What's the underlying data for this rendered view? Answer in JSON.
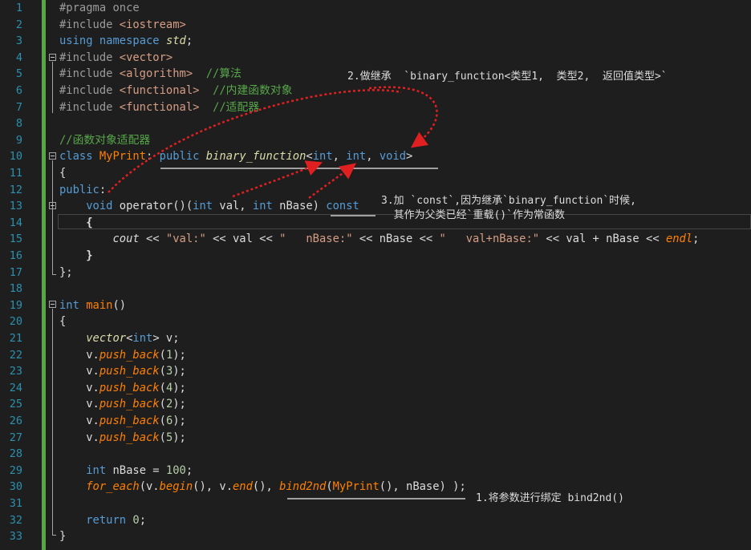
{
  "line_numbers": [
    "1",
    "2",
    "3",
    "4",
    "5",
    "6",
    "7",
    "8",
    "9",
    "10",
    "11",
    "12",
    "13",
    "14",
    "15",
    "16",
    "17",
    "18",
    "19",
    "20",
    "21",
    "22",
    "23",
    "24",
    "25",
    "26",
    "27",
    "28",
    "29",
    "30",
    "31",
    "32",
    "33"
  ],
  "code": {
    "l1": {
      "pp": "#pragma once"
    },
    "l2": {
      "pp": "#include ",
      "inc": "<iostream>"
    },
    "l3": {
      "kw1": "using",
      "kw2": "namespace",
      "ns": "std",
      "semi": ";"
    },
    "l4": {
      "pp": "#include ",
      "inc": "<vector>"
    },
    "l5": {
      "pp": "#include ",
      "inc": "<algorithm>",
      "cm": "  //算法"
    },
    "l6": {
      "pp": "#include ",
      "inc": "<functional>",
      "cm": "  //内建函数对象"
    },
    "l7": {
      "pp": "#include ",
      "inc": "<functional>",
      "cm": "  //适配器"
    },
    "l9": {
      "cm": "//函数对象适配器"
    },
    "l10": {
      "kw": "class",
      "name": "MyPrint",
      "colon": ": ",
      "pub": "public",
      "base": "binary_function",
      "lt": "<",
      "t1": "int",
      "c1": ", ",
      "t2": "int",
      "c2": ", ",
      "t3": "void",
      "gt": ">"
    },
    "l11": {
      "brace": "{"
    },
    "l12": {
      "kw": "public",
      "colon": ":"
    },
    "l13": {
      "indent": "    ",
      "void": "void",
      "op": " operator()(",
      "int1": "int",
      "p1": " val, ",
      "int2": "int",
      "p2": " nBase) ",
      "const": "const"
    },
    "l14": {
      "indent": "    ",
      "brace": "{"
    },
    "l15": {
      "indent": "        ",
      "cout": "cout",
      "a": " << ",
      "s1": "\"val:\"",
      "b": " << val << ",
      "s2": "\"   nBase:\"",
      "c": " << nBase << ",
      "s3": "\"   val+nBase:\"",
      "d": " << val + nBase << ",
      "endl": "endl",
      "e": ";"
    },
    "l16": {
      "indent": "    ",
      "brace": "}"
    },
    "l17": {
      "brace": "};"
    },
    "l19": {
      "int": "int",
      "main": "main",
      "rest": "()"
    },
    "l20": {
      "brace": "{"
    },
    "l21": {
      "indent": "    ",
      "vector": "vector",
      "lt": "<",
      "int": "int",
      "rest": "> v;"
    },
    "l22": {
      "indent": "    ",
      "v": "v.",
      "fn": "push_back",
      "open": "(",
      "n": "1",
      "close": ");"
    },
    "l23": {
      "indent": "    ",
      "v": "v.",
      "fn": "push_back",
      "open": "(",
      "n": "3",
      "close": ");"
    },
    "l24": {
      "indent": "    ",
      "v": "v.",
      "fn": "push_back",
      "open": "(",
      "n": "4",
      "close": ");"
    },
    "l25": {
      "indent": "    ",
      "v": "v.",
      "fn": "push_back",
      "open": "(",
      "n": "2",
      "close": ");"
    },
    "l26": {
      "indent": "    ",
      "v": "v.",
      "fn": "push_back",
      "open": "(",
      "n": "6",
      "close": ");"
    },
    "l27": {
      "indent": "    ",
      "v": "v.",
      "fn": "push_back",
      "open": "(",
      "n": "5",
      "close": ");"
    },
    "l29": {
      "indent": "    ",
      "int": "int",
      "rest": " nBase = ",
      "n": "100",
      "semi": ";"
    },
    "l30": {
      "indent": "    ",
      "for_each": "for_each",
      "a": "(v.",
      "begin": "begin",
      "b": "(), v.",
      "end": "end",
      "c": "(), ",
      "bind2nd": "bind2nd",
      "d": "(",
      "cls": "MyPrint",
      "e": "(), nBase) );"
    },
    "l32": {
      "indent": "    ",
      "kw": "return",
      "sp": " ",
      "n": "0",
      "semi": ";"
    },
    "l33": {
      "brace": "}"
    }
  },
  "annotations": {
    "note1": "1.将参数进行绑定 bind2nd()",
    "note2": "2.做继承  `binary_function<类型1,  类型2,  返回值类型>`",
    "note3_line1": "3.加 `const`,因为继承`binary_function`时候,",
    "note3_line2": "  其作为父类已经`重载()`作为常函数"
  },
  "colors": {
    "background": "#1e1e1e",
    "line_number": "#2b91af",
    "keyword": "#569cd6",
    "comment": "#57a64a",
    "string": "#d69d85",
    "class_name": "#4ec9b0",
    "function": "#ff8000",
    "arrow": "#e02020"
  }
}
